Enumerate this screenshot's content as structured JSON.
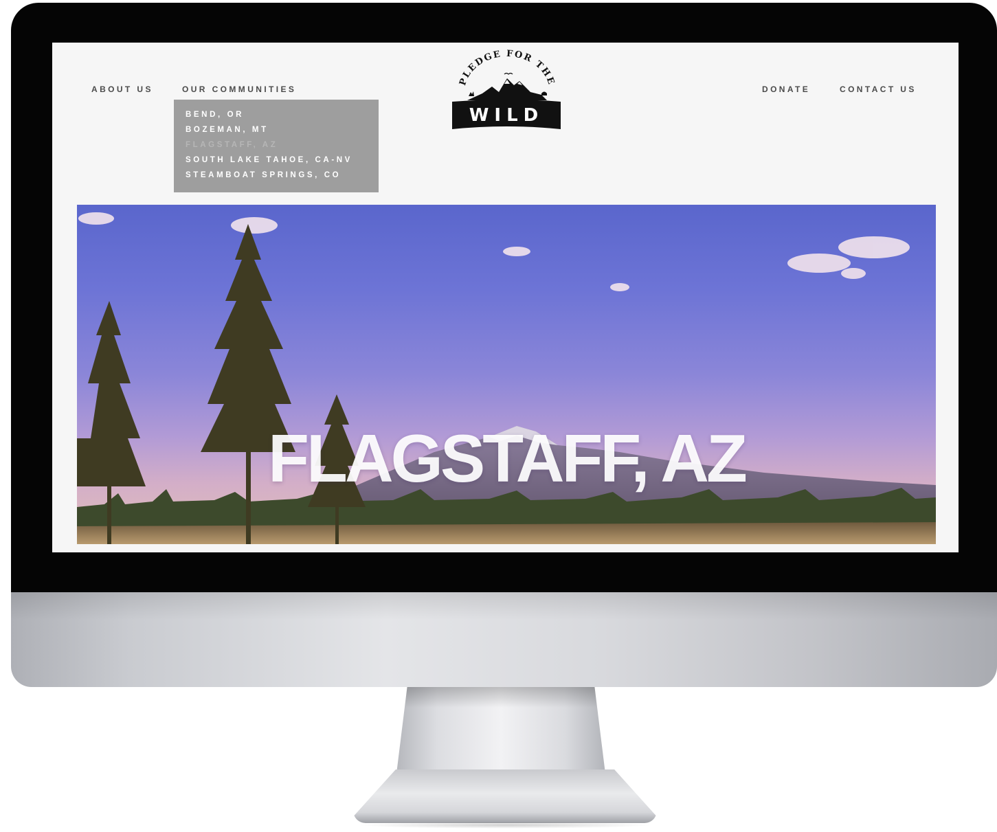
{
  "nav": {
    "about_label": "ABOUT US",
    "communities_label": "OUR COMMUNITIES",
    "donate_label": "DONATE",
    "contact_label": "CONTACT US"
  },
  "dropdown": {
    "items": [
      {
        "label": "BEND, OR"
      },
      {
        "label": "BOZEMAN, MT"
      },
      {
        "label": "FLAGSTAFF, AZ"
      },
      {
        "label": "SOUTH LAKE TAHOE, CA-NV"
      },
      {
        "label": "STEAMBOAT SPRINGS, CO"
      }
    ],
    "active_index": 2
  },
  "logo": {
    "arc_text": "PLEDGE FOR THE",
    "badge_text": "WILD"
  },
  "hero": {
    "title": "FLAGSTAFF, AZ"
  },
  "colors": {
    "page_background": "#f6f6f6",
    "dropdown_background": "#9e9e9e",
    "nav_text": "#4b4b4b",
    "bezel": "#050505"
  }
}
